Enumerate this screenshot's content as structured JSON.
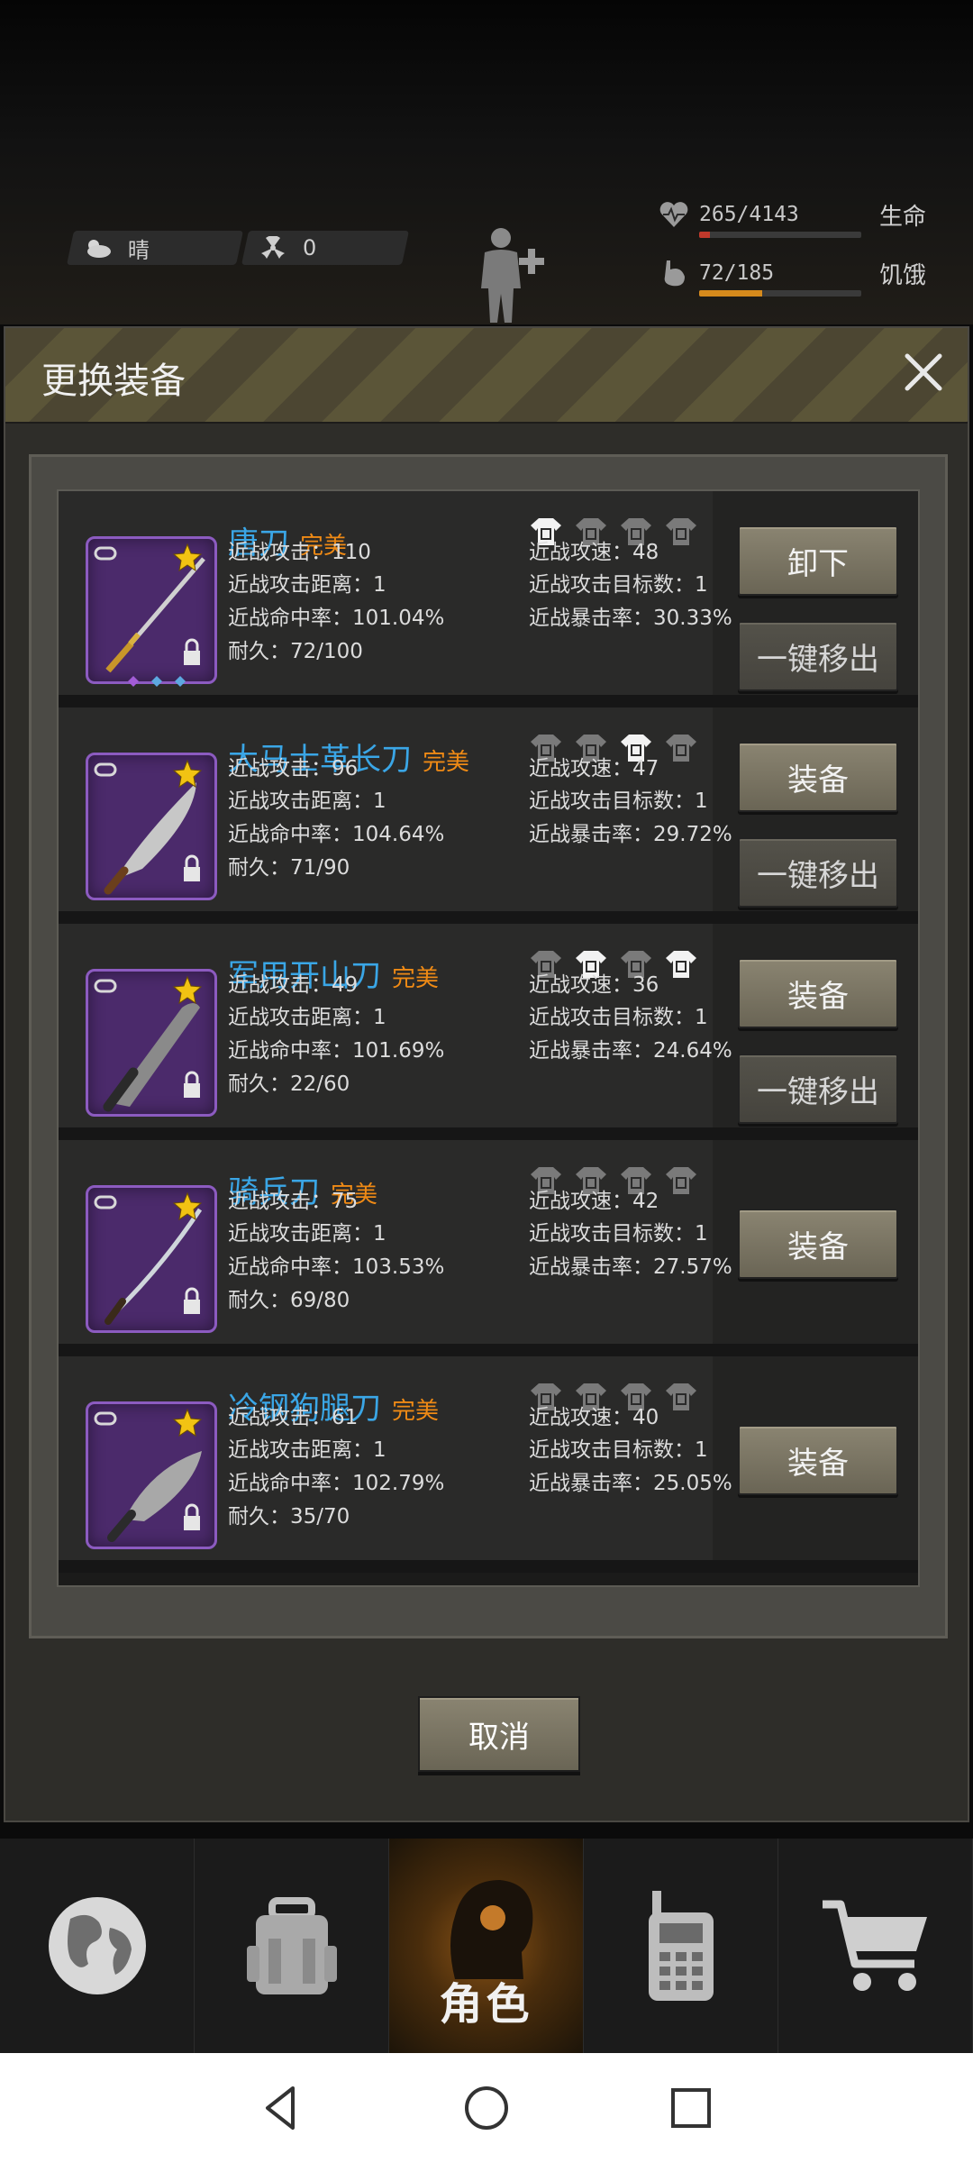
{
  "status": {
    "weather_label": "晴",
    "radiation_value": "0"
  },
  "vitals": {
    "health": {
      "value": "265/4143",
      "label": "生命",
      "fill": 0.064,
      "color": "#c0392b"
    },
    "hunger": {
      "value": "72/185",
      "label": "饥饿",
      "fill": 0.389,
      "color": "#d68a1c"
    }
  },
  "modal": {
    "title": "更换装备",
    "cancel_label": "取消"
  },
  "items": [
    {
      "name": "唐刀",
      "quality": "完美",
      "stats": [
        "近战攻击：110",
        "近战攻击距离：1",
        "近战命中率：101.04%",
        "耐久：72/100"
      ],
      "stats_right": [
        "近战攻速：48",
        "近战攻击目标数：1",
        "近战暴击率：30.33%"
      ],
      "buttons": [
        "卸下",
        "一键移出"
      ],
      "shirts": [
        "on",
        "off",
        "off",
        "off"
      ]
    },
    {
      "name": "大马士革长刀",
      "quality": "完美",
      "stats": [
        "近战攻击：96",
        "近战攻击距离：1",
        "近战命中率：104.64%",
        "耐久：71/90"
      ],
      "stats_right": [
        "近战攻速：47",
        "近战攻击目标数：1",
        "近战暴击率：29.72%"
      ],
      "buttons": [
        "装备",
        "一键移出"
      ],
      "shirts": [
        "off",
        "off",
        "on",
        "off"
      ]
    },
    {
      "name": "军用开山刀",
      "quality": "完美",
      "stats": [
        "近战攻击：49",
        "近战攻击距离：1",
        "近战命中率：101.69%",
        "耐久：22/60"
      ],
      "stats_right": [
        "近战攻速：36",
        "近战攻击目标数：1",
        "近战暴击率：24.64%"
      ],
      "buttons": [
        "装备",
        "一键移出"
      ],
      "shirts": [
        "off",
        "on",
        "off",
        "on"
      ]
    },
    {
      "name": "骑兵刀",
      "quality": "完美",
      "stats": [
        "近战攻击：75",
        "近战攻击距离：1",
        "近战命中率：103.53%",
        "耐久：69/80"
      ],
      "stats_right": [
        "近战攻速：42",
        "近战攻击目标数：1",
        "近战暴击率：27.57%"
      ],
      "buttons": [
        "装备"
      ],
      "shirts": [
        "off",
        "off",
        "off",
        "off"
      ]
    },
    {
      "name": "冷钢狗腿刀",
      "quality": "完美",
      "stats": [
        "近战攻击：61",
        "近战攻击距离：1",
        "近战命中率：102.79%",
        "耐久：35/70"
      ],
      "stats_right": [
        "近战攻速：40",
        "近战攻击目标数：1",
        "近战暴击率：25.05%"
      ],
      "buttons": [
        "装备"
      ],
      "shirts": [
        "off",
        "off",
        "off",
        "off"
      ]
    }
  ],
  "nav": {
    "tabs": [
      "world",
      "backpack",
      "character",
      "radio",
      "shop"
    ],
    "active_label": "角色"
  },
  "colors": {
    "name": "#3aa6e6",
    "quality": "#ef8a15",
    "item_frame": "#8c5bc0"
  }
}
